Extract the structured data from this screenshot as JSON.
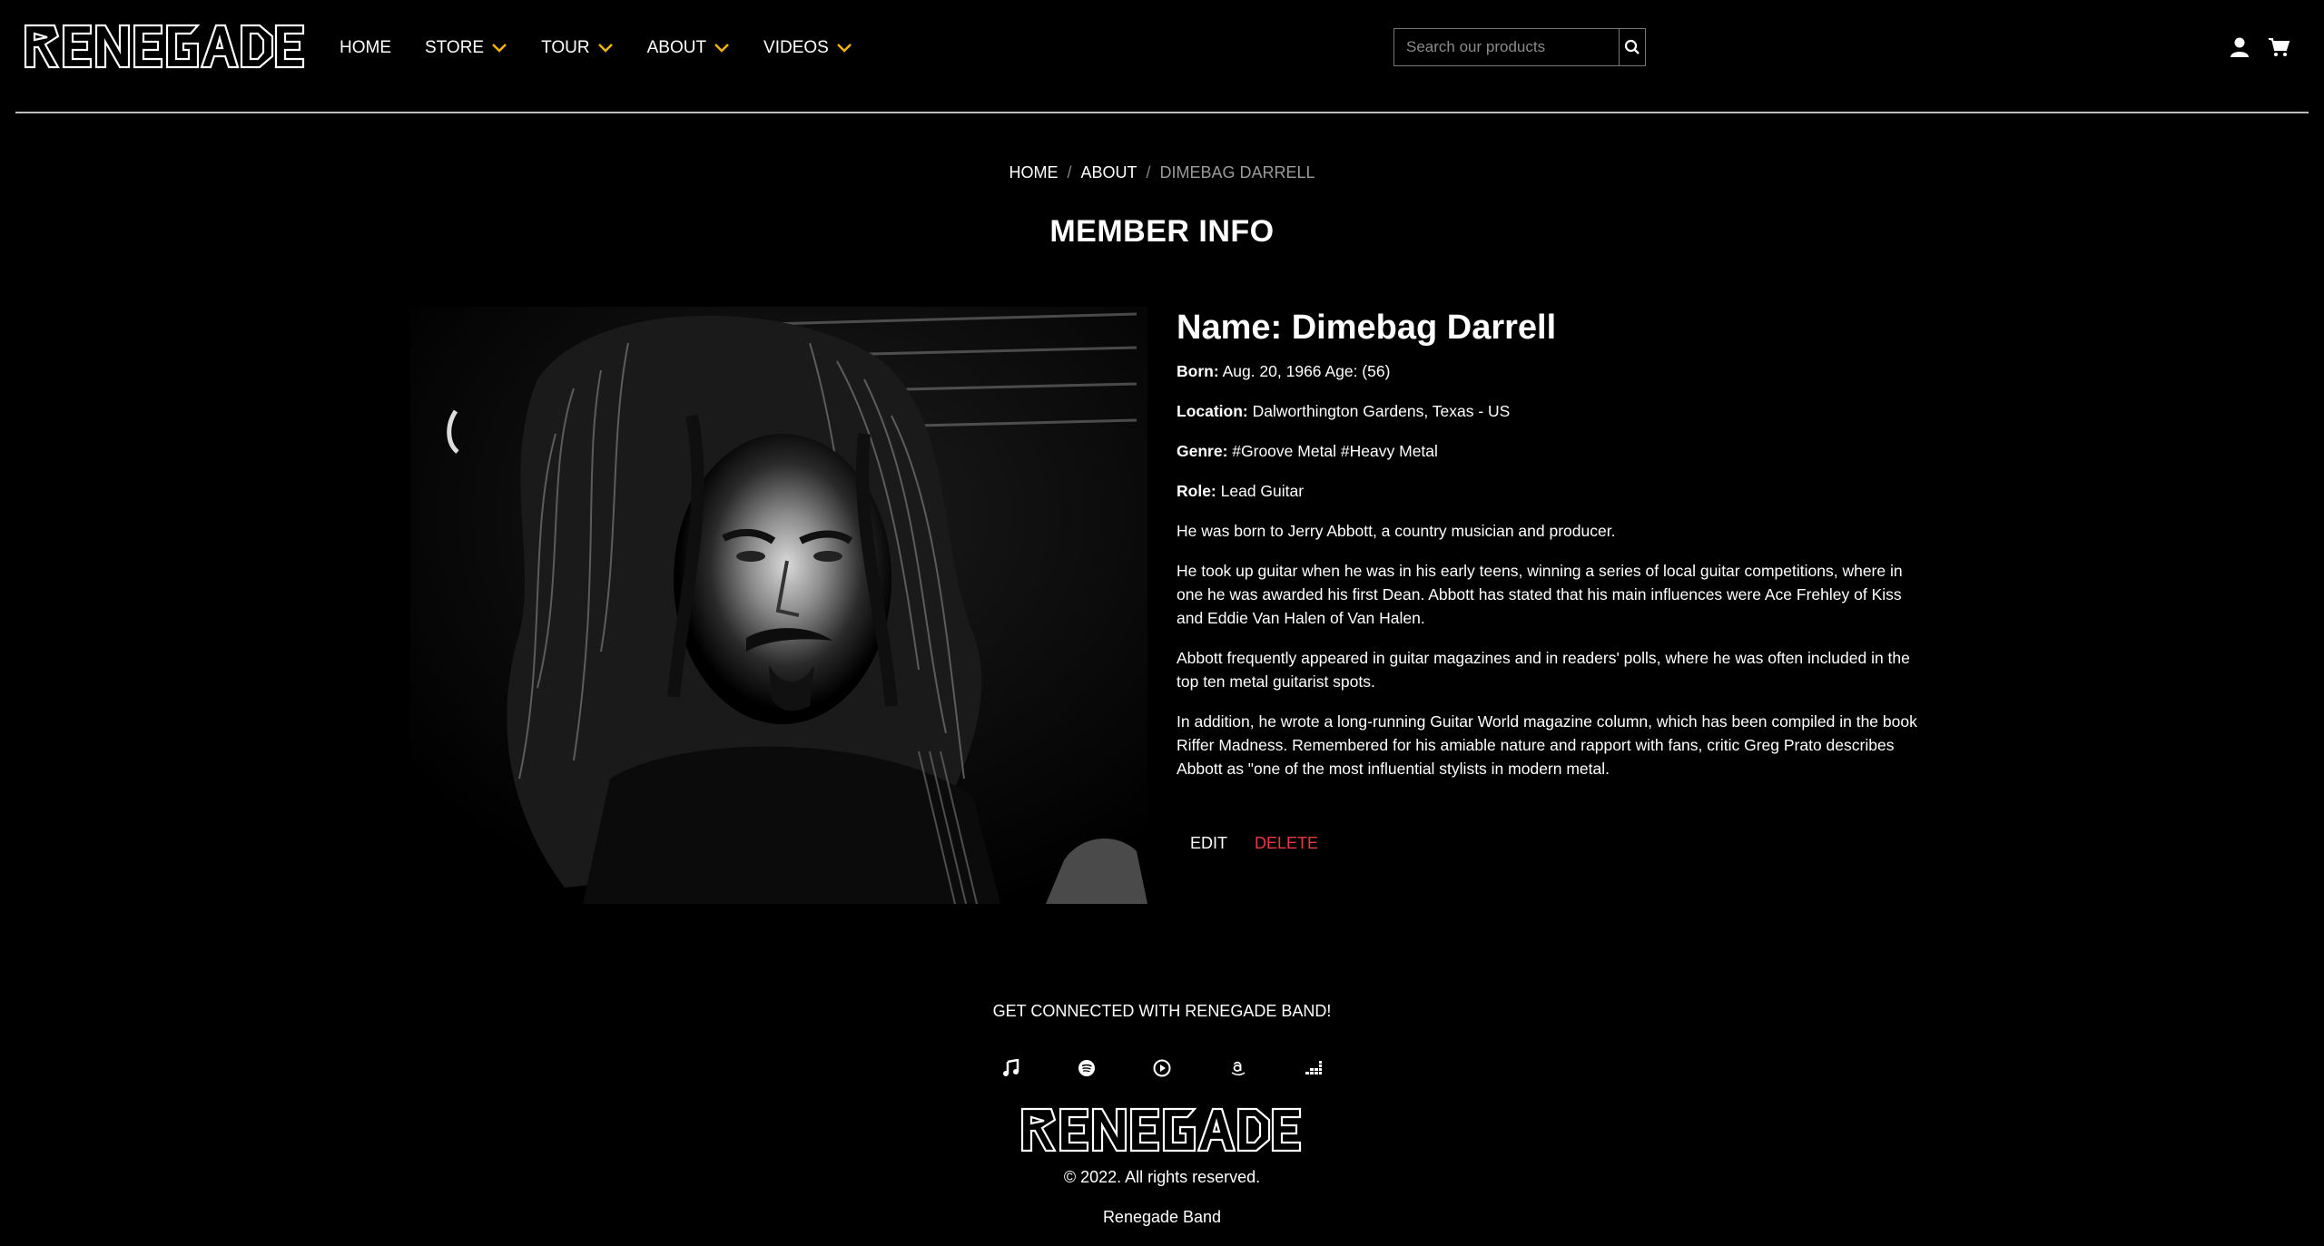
{
  "brand": {
    "logo_text": "RENEGADE"
  },
  "nav": {
    "home": "HOME",
    "store": "STORE",
    "tour": "TOUR",
    "about": "ABOUT",
    "videos": "VIDEOS"
  },
  "search": {
    "placeholder": "Search our products",
    "value": ""
  },
  "icons": {
    "search": "search-icon",
    "user": "user-icon",
    "cart": "cart-icon",
    "chevron": "chevron-down-icon",
    "socials": [
      "music-note-icon",
      "spotify-icon",
      "play-circle-icon",
      "amazon-icon",
      "deezer-icon"
    ]
  },
  "colors": {
    "accent_chevron": "#f5b400",
    "delete": "#e53948",
    "background": "#000000"
  },
  "breadcrumb": {
    "home": "HOME",
    "about": "ABOUT",
    "current": "DIMEBAG DARRELL",
    "separator": "/"
  },
  "page_title": "MEMBER INFO",
  "member": {
    "name_label": "Name:",
    "name": "Dimebag Darrell",
    "born_label": "Born:",
    "born": "Aug. 20, 1966 Age: (56)",
    "location_label": "Location:",
    "location": "Dalworthington Gardens, Texas - US",
    "genre_label": "Genre:",
    "genre": "#Groove Metal #Heavy Metal",
    "role_label": "Role:",
    "role": "Lead Guitar",
    "bio": [
      "He was born to Jerry Abbott, a country musician and producer.",
      "He took up guitar when he was in his early teens, winning a series of local guitar competitions, where in one he was awarded his first Dean. Abbott has stated that his main influences were Ace Frehley of Kiss and Eddie Van Halen of Van Halen.",
      "Abbott frequently appeared in guitar magazines and in readers' polls, where he was often included in the top ten metal guitarist spots.",
      "In addition, he wrote a long-running Guitar World magazine column, which has been compiled in the book Riffer Madness. Remembered for his amiable nature and rapport with fans, critic Greg Prato describes Abbott as \"one of the most influential stylists in modern metal."
    ]
  },
  "actions": {
    "edit": "EDIT",
    "delete": "DELETE"
  },
  "footer": {
    "connect": "GET CONNECTED WITH RENEGADE BAND!",
    "copyright": "© 2022. All rights reserved.",
    "band": "Renegade Band"
  }
}
